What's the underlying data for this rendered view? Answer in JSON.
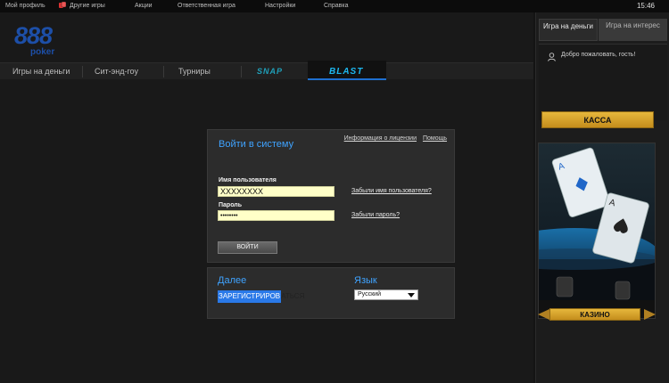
{
  "menubar": {
    "items": [
      "Мой профиль",
      "Другие игры",
      "Акции",
      "Ответственная игра",
      "Настройки",
      "Справка"
    ],
    "clock": "15:46"
  },
  "logo": {
    "number": "888",
    "sub": "poker"
  },
  "nav": {
    "tabs": [
      "Игры на деньги",
      "Сит-энд-гоу",
      "Турниры",
      "SNAP",
      "BLAST"
    ],
    "active": "BLAST"
  },
  "login": {
    "title": "Войти в систему",
    "license_link": "Информация о лицензии",
    "help_link": "Помощь",
    "username_label": "Имя пользователя",
    "username_value": "XXXXXXXX",
    "password_label": "Пароль",
    "password_value": "••••••••",
    "forgot_username": "Забыли имя пользователя?",
    "forgot_password": "Забыли пароль?",
    "login_button": "ВОЙТИ"
  },
  "next": {
    "title": "Далее",
    "register_highlight": "ЗАРЕГИСТРИРОВ",
    "register_rest": "АТЬСЯ"
  },
  "language": {
    "title": "Язык",
    "selected": "Русский"
  },
  "sidebar": {
    "tab_money": "Игра на деньги",
    "tab_fun": "Игра на интерес",
    "welcome": "Добро пожаловать, гость!",
    "cashier": "КАССА",
    "casino": "КАЗИНО"
  },
  "colors": {
    "accent_blue": "#3fa3ff",
    "gold": "#d4a22c",
    "brand": "#1d4fa8"
  }
}
